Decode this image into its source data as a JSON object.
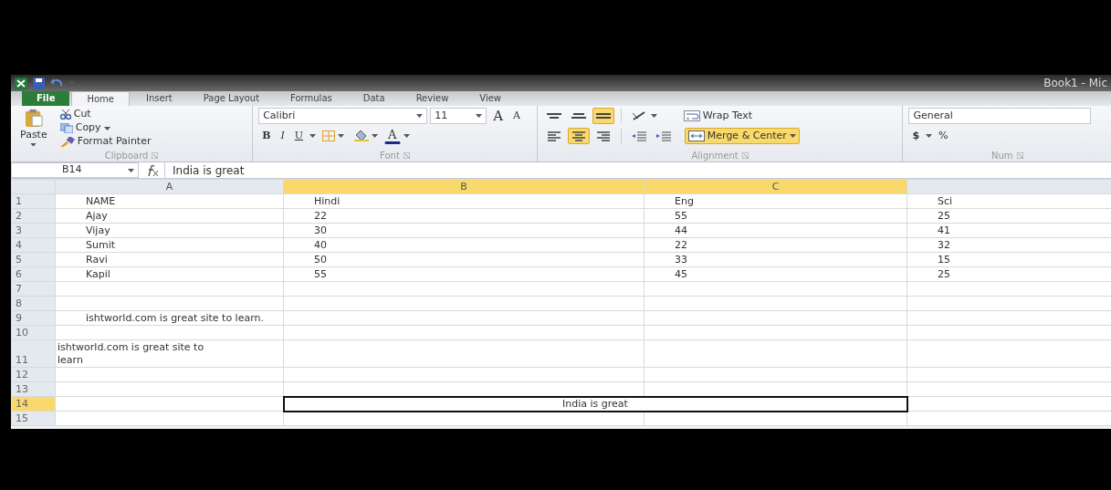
{
  "window": {
    "title": "Book1 - Mic"
  },
  "tabs": [
    {
      "label": "File",
      "kind": "file",
      "selected": false
    },
    {
      "label": "Home",
      "kind": "tab",
      "selected": true
    },
    {
      "label": "Insert",
      "kind": "tab",
      "selected": false
    },
    {
      "label": "Page Layout",
      "kind": "tab",
      "selected": false
    },
    {
      "label": "Formulas",
      "kind": "tab",
      "selected": false
    },
    {
      "label": "Data",
      "kind": "tab",
      "selected": false
    },
    {
      "label": "Review",
      "kind": "tab",
      "selected": false
    },
    {
      "label": "View",
      "kind": "tab",
      "selected": false
    }
  ],
  "ribbon": {
    "clipboard": {
      "paste": "Paste",
      "cut": "Cut",
      "copy": "Copy",
      "format_painter": "Format Painter",
      "group": "Clipboard"
    },
    "font": {
      "name": "Calibri",
      "size": "11",
      "grow": "A",
      "shrink": "A",
      "bold": "B",
      "italic": "I",
      "underline": "U",
      "font_color_button": "A",
      "group": "Font"
    },
    "alignment": {
      "vertical": [
        {
          "kind": "top",
          "selected": false
        },
        {
          "kind": "middle",
          "selected": false
        },
        {
          "kind": "bottom",
          "selected": true
        }
      ],
      "horizontal": [
        {
          "kind": "left",
          "selected": false
        },
        {
          "kind": "center",
          "selected": true
        },
        {
          "kind": "right",
          "selected": false
        }
      ],
      "wrap_text": "Wrap Text",
      "merge": "Merge & Center",
      "merge_selected": true,
      "group": "Alignment"
    },
    "number": {
      "format": "General",
      "currency": "$",
      "percent": "%",
      "group": "Num"
    }
  },
  "formula_bar": {
    "name_box": "B14",
    "value": "India is great"
  },
  "sheet": {
    "columns": [
      {
        "label": "A",
        "selected": false
      },
      {
        "label": "B",
        "selected": true
      },
      {
        "label": "C",
        "selected": true
      }
    ],
    "rows": [
      {
        "number": "1",
        "selected": false,
        "kind": "data",
        "cells": [
          "NAME",
          "Hindi",
          "Eng",
          "Sci"
        ]
      },
      {
        "number": "2",
        "selected": false,
        "kind": "data",
        "cells": [
          "Ajay",
          "22",
          "55",
          "25"
        ]
      },
      {
        "number": "3",
        "selected": false,
        "kind": "data",
        "cells": [
          "Vijay",
          "30",
          "44",
          "41"
        ]
      },
      {
        "number": "4",
        "selected": false,
        "kind": "data",
        "cells": [
          "Sumit",
          "40",
          "22",
          "32"
        ]
      },
      {
        "number": "5",
        "selected": false,
        "kind": "data",
        "cells": [
          "Ravi",
          "50",
          "33",
          "15"
        ]
      },
      {
        "number": "6",
        "selected": false,
        "kind": "data",
        "cells": [
          "Kapil",
          "55",
          "45",
          "25"
        ]
      },
      {
        "number": "7",
        "selected": false,
        "kind": "empty"
      },
      {
        "number": "8",
        "selected": false,
        "kind": "empty"
      },
      {
        "number": "9",
        "selected": false,
        "kind": "overflow",
        "text": "ishtworld.com is great site to learn."
      },
      {
        "number": "10",
        "selected": false,
        "kind": "empty"
      },
      {
        "number": "11",
        "selected": false,
        "kind": "wrapped",
        "text": "ishtworld.com is great site to learn"
      },
      {
        "number": "12",
        "selected": false,
        "kind": "empty"
      },
      {
        "number": "13",
        "selected": false,
        "kind": "empty"
      },
      {
        "number": "14",
        "selected": true,
        "kind": "merged",
        "text": "India is great"
      },
      {
        "number": "15",
        "selected": false,
        "kind": "empty"
      }
    ]
  }
}
